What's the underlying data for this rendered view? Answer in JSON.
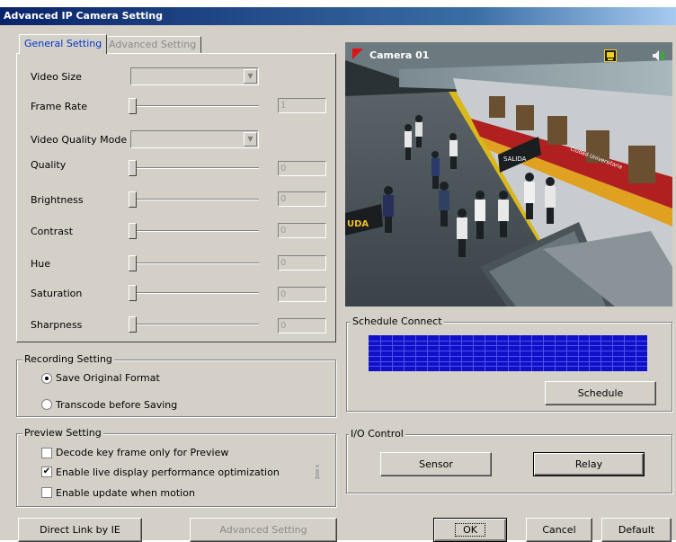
{
  "window": {
    "title": "Advanced IP Camera Setting"
  },
  "tabs": {
    "general": "General Setting",
    "advanced": "Advanced Setting"
  },
  "general": {
    "video_size_label": "Video Size",
    "frame_rate_label": "Frame Rate",
    "frame_rate_value": "1",
    "video_quality_mode_label": "Video Quality Mode",
    "sliders": [
      {
        "label": "Quality",
        "value": "0"
      },
      {
        "label": "Brightness",
        "value": "0"
      },
      {
        "label": "Contrast",
        "value": "0"
      },
      {
        "label": "Hue",
        "value": "0"
      },
      {
        "label": "Saturation",
        "value": "0"
      },
      {
        "label": "Sharpness",
        "value": "0"
      }
    ]
  },
  "recording": {
    "title": "Recording Setting",
    "save_original": "Save Original Format",
    "transcode": "Transcode before Saving",
    "selected": "save_original"
  },
  "preview": {
    "title": "Preview Setting",
    "decode_key_frame": "Decode key frame only for Preview",
    "decode_key_frame_checked": false,
    "enable_live": "Enable live display performance optimization",
    "enable_live_checked": true,
    "enable_update": "Enable update when motion",
    "enable_update_checked": false
  },
  "camera": {
    "name": "Camera 01",
    "sign_text": "SALIDA",
    "train_text": "Ciudad Universitaria",
    "platform_sign": "UDA"
  },
  "schedule": {
    "title": "Schedule Connect",
    "button": "Schedule",
    "grid_color": "#1010c8"
  },
  "io": {
    "title": "I/O Control",
    "sensor": "Sensor",
    "relay": "Relay"
  },
  "buttons": {
    "direct_link": "Direct Link by IE",
    "advanced_setting": "Advanced Setting",
    "ok": "OK",
    "cancel": "Cancel",
    "default": "Default"
  }
}
